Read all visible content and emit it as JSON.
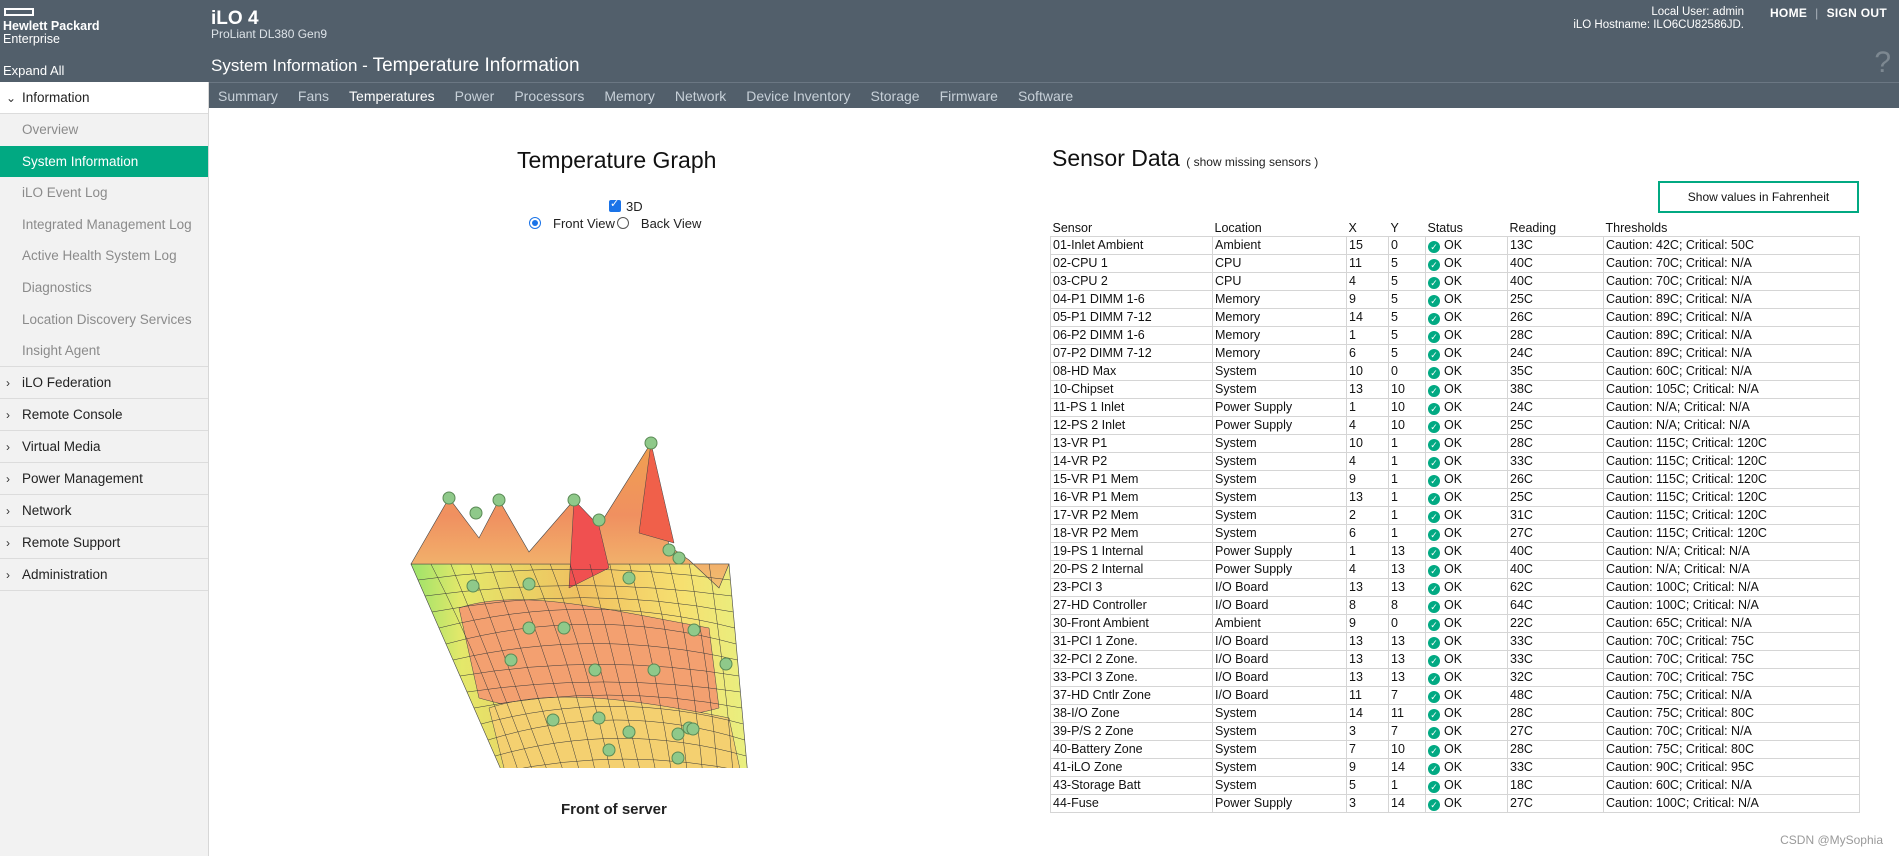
{
  "logo": {
    "line1": "Hewlett Packard",
    "line2": "Enterprise"
  },
  "sidebar": {
    "expand_all": "Expand All",
    "information": "Information",
    "sub_items": [
      "Overview",
      "System Information",
      "iLO Event Log",
      "Integrated Management Log",
      "Active Health System Log",
      "Diagnostics",
      "Location Discovery Services",
      "Insight Agent"
    ],
    "sections": [
      "iLO Federation",
      "Remote Console",
      "Virtual Media",
      "Power Management",
      "Network",
      "Remote Support",
      "Administration"
    ]
  },
  "header": {
    "product": "iLO 4",
    "model": "ProLiant DL380 Gen9",
    "page_prefix": "System Information - ",
    "page_title": "Temperature Information",
    "user": "Local User: admin",
    "hostname": "iLO Hostname: ILO6CU82586JD.",
    "home": "HOME",
    "sep": "|",
    "signout": "SIGN OUT",
    "help": "?"
  },
  "tabs": [
    "Summary",
    "Fans",
    "Temperatures",
    "Power",
    "Processors",
    "Memory",
    "Network",
    "Device Inventory",
    "Storage",
    "Firmware",
    "Software"
  ],
  "graph": {
    "title": "Temperature Graph",
    "opt_3d": "3D",
    "front_view": "Front View",
    "back_view": "Back View",
    "caption": "Front of server"
  },
  "sensor_panel": {
    "title": "Sensor Data",
    "show_missing": "( show missing sensors )",
    "fahrenheit_button": "Show values in Fahrenheit",
    "columns": [
      "Sensor",
      "Location",
      "X",
      "Y",
      "Status",
      "Reading",
      "Thresholds"
    ],
    "rows": [
      [
        "01-Inlet Ambient",
        "Ambient",
        "15",
        "0",
        "OK",
        "13C",
        "Caution: 42C; Critical: 50C"
      ],
      [
        "02-CPU 1",
        "CPU",
        "11",
        "5",
        "OK",
        "40C",
        "Caution: 70C; Critical: N/A"
      ],
      [
        "03-CPU 2",
        "CPU",
        "4",
        "5",
        "OK",
        "40C",
        "Caution: 70C; Critical: N/A"
      ],
      [
        "04-P1 DIMM 1-6",
        "Memory",
        "9",
        "5",
        "OK",
        "25C",
        "Caution: 89C; Critical: N/A"
      ],
      [
        "05-P1 DIMM 7-12",
        "Memory",
        "14",
        "5",
        "OK",
        "26C",
        "Caution: 89C; Critical: N/A"
      ],
      [
        "06-P2 DIMM 1-6",
        "Memory",
        "1",
        "5",
        "OK",
        "28C",
        "Caution: 89C; Critical: N/A"
      ],
      [
        "07-P2 DIMM 7-12",
        "Memory",
        "6",
        "5",
        "OK",
        "24C",
        "Caution: 89C; Critical: N/A"
      ],
      [
        "08-HD Max",
        "System",
        "10",
        "0",
        "OK",
        "35C",
        "Caution: 60C; Critical: N/A"
      ],
      [
        "10-Chipset",
        "System",
        "13",
        "10",
        "OK",
        "38C",
        "Caution: 105C; Critical: N/A"
      ],
      [
        "11-PS 1 Inlet",
        "Power Supply",
        "1",
        "10",
        "OK",
        "24C",
        "Caution: N/A; Critical: N/A"
      ],
      [
        "12-PS 2 Inlet",
        "Power Supply",
        "4",
        "10",
        "OK",
        "25C",
        "Caution: N/A; Critical: N/A"
      ],
      [
        "13-VR P1",
        "System",
        "10",
        "1",
        "OK",
        "28C",
        "Caution: 115C; Critical: 120C"
      ],
      [
        "14-VR P2",
        "System",
        "4",
        "1",
        "OK",
        "33C",
        "Caution: 115C; Critical: 120C"
      ],
      [
        "15-VR P1 Mem",
        "System",
        "9",
        "1",
        "OK",
        "26C",
        "Caution: 115C; Critical: 120C"
      ],
      [
        "16-VR P1 Mem",
        "System",
        "13",
        "1",
        "OK",
        "25C",
        "Caution: 115C; Critical: 120C"
      ],
      [
        "17-VR P2 Mem",
        "System",
        "2",
        "1",
        "OK",
        "31C",
        "Caution: 115C; Critical: 120C"
      ],
      [
        "18-VR P2 Mem",
        "System",
        "6",
        "1",
        "OK",
        "27C",
        "Caution: 115C; Critical: 120C"
      ],
      [
        "19-PS 1 Internal",
        "Power Supply",
        "1",
        "13",
        "OK",
        "40C",
        "Caution: N/A; Critical: N/A"
      ],
      [
        "20-PS 2 Internal",
        "Power Supply",
        "4",
        "13",
        "OK",
        "40C",
        "Caution: N/A; Critical: N/A"
      ],
      [
        "23-PCI 3",
        "I/O Board",
        "13",
        "13",
        "OK",
        "62C",
        "Caution: 100C; Critical: N/A"
      ],
      [
        "27-HD Controller",
        "I/O Board",
        "8",
        "8",
        "OK",
        "64C",
        "Caution: 100C; Critical: N/A"
      ],
      [
        "30-Front Ambient",
        "Ambient",
        "9",
        "0",
        "OK",
        "22C",
        "Caution: 65C; Critical: N/A"
      ],
      [
        "31-PCI 1 Zone.",
        "I/O Board",
        "13",
        "13",
        "OK",
        "33C",
        "Caution: 70C; Critical: 75C"
      ],
      [
        "32-PCI 2 Zone.",
        "I/O Board",
        "13",
        "13",
        "OK",
        "33C",
        "Caution: 70C; Critical: 75C"
      ],
      [
        "33-PCI 3 Zone.",
        "I/O Board",
        "13",
        "13",
        "OK",
        "32C",
        "Caution: 70C; Critical: 75C"
      ],
      [
        "37-HD Cntlr Zone",
        "I/O Board",
        "11",
        "7",
        "OK",
        "48C",
        "Caution: 75C; Critical: N/A"
      ],
      [
        "38-I/O Zone",
        "System",
        "14",
        "11",
        "OK",
        "28C",
        "Caution: 75C; Critical: 80C"
      ],
      [
        "39-P/S 2 Zone",
        "System",
        "3",
        "7",
        "OK",
        "27C",
        "Caution: 70C; Critical: N/A"
      ],
      [
        "40-Battery Zone",
        "System",
        "7",
        "10",
        "OK",
        "28C",
        "Caution: 75C; Critical: 80C"
      ],
      [
        "41-iLO Zone",
        "System",
        "9",
        "14",
        "OK",
        "33C",
        "Caution: 90C; Critical: 95C"
      ],
      [
        "43-Storage Batt",
        "System",
        "5",
        "1",
        "OK",
        "18C",
        "Caution: 60C; Critical: N/A"
      ],
      [
        "44-Fuse",
        "Power Supply",
        "3",
        "14",
        "OK",
        "27C",
        "Caution: 100C; Critical: N/A"
      ]
    ]
  },
  "footer_mark": "CSDN @MySophia",
  "colors": {
    "header_bg": "#525f6b",
    "accent": "#01a982"
  }
}
